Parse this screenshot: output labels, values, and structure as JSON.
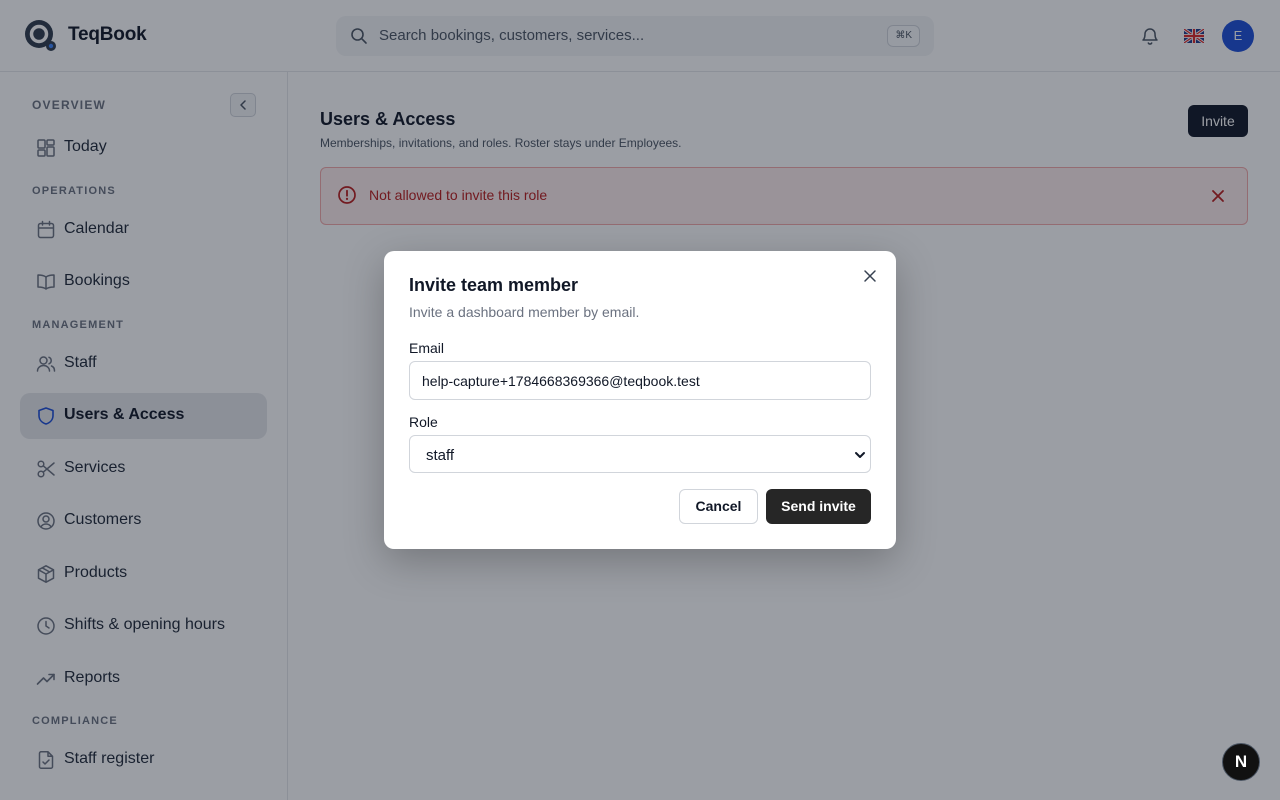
{
  "app": {
    "brand": "TeqBook",
    "logo_icon": "teqbook-logo-icon"
  },
  "header": {
    "search_placeholder": "Search bookings, customers, services...",
    "search_shortcut": "⌘K",
    "notification_icon": "bell-icon",
    "language_icon": "uk-flag-icon",
    "avatar_initial": "E",
    "avatar_color": "#1d4ed8"
  },
  "sidebar": {
    "sections": {
      "overview": "OVERVIEW",
      "operations": "OPERATIONS",
      "management": "MANAGEMENT",
      "compliance": "COMPLIANCE"
    },
    "items": [
      {
        "label": "Today",
        "icon": "dashboard-grid-icon"
      },
      {
        "label": "Calendar",
        "icon": "calendar-icon"
      },
      {
        "label": "Bookings",
        "icon": "book-icon"
      },
      {
        "label": "Staff",
        "icon": "users-icon"
      },
      {
        "label": "Users & Access",
        "icon": "shield-icon",
        "active": true
      },
      {
        "label": "Services",
        "icon": "scissors-icon"
      },
      {
        "label": "Customers",
        "icon": "user-circle-icon"
      },
      {
        "label": "Products",
        "icon": "package-icon"
      },
      {
        "label": "Shifts & opening hours",
        "icon": "clock-icon"
      },
      {
        "label": "Reports",
        "icon": "trending-up-icon"
      },
      {
        "label": "Staff register",
        "icon": "file-check-icon"
      }
    ]
  },
  "main": {
    "title": "Users & Access",
    "subtitle": "Memberships, invitations, and roles. Roster stays under Employees.",
    "invite_label": "Invite",
    "alert": {
      "message": "Not allowed to invite this role",
      "color": "#b91c1c"
    }
  },
  "modal": {
    "title": "Invite team member",
    "description": "Invite a dashboard member by email.",
    "email_label": "Email",
    "email_value": "help-capture+1784668369366@teqbook.test",
    "role_label": "Role",
    "role_value": "staff",
    "cancel_label": "Cancel",
    "send_label": "Send invite"
  },
  "badge": {
    "label": "N"
  }
}
